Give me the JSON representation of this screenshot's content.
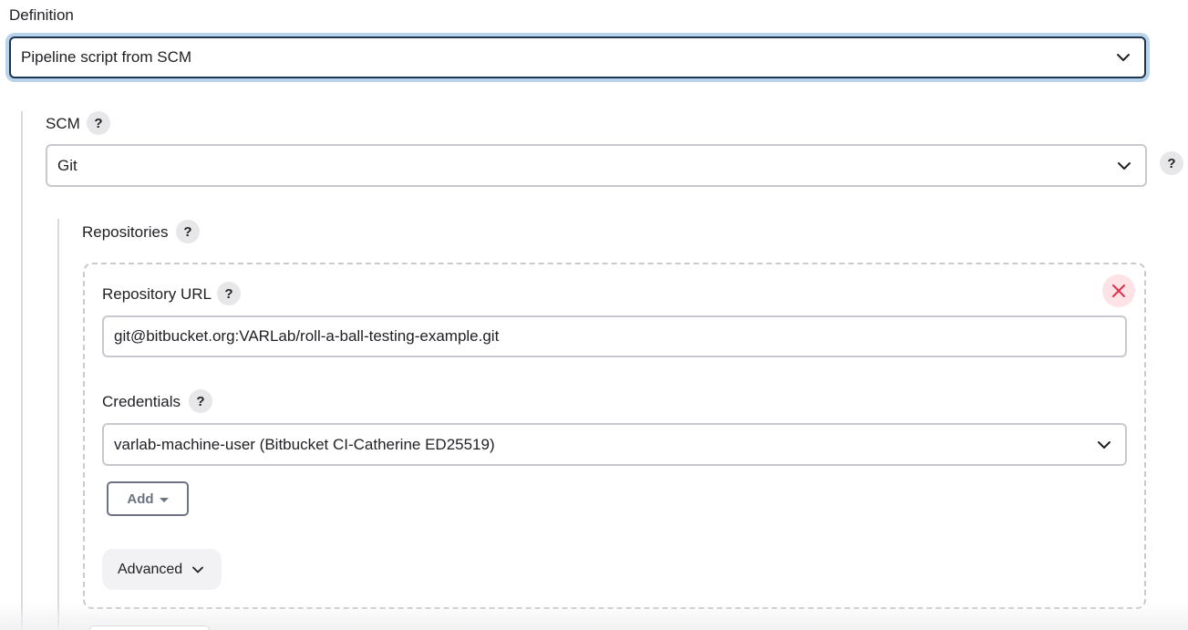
{
  "definition": {
    "label": "Definition",
    "selected": "Pipeline script from SCM"
  },
  "scm": {
    "label": "SCM",
    "help": "?",
    "selected": "Git",
    "side_help": "?"
  },
  "repositories": {
    "label": "Repositories",
    "help": "?",
    "repository_url": {
      "label": "Repository URL",
      "help": "?",
      "value": "git@bitbucket.org:VARLab/roll-a-ball-testing-example.git"
    },
    "credentials": {
      "label": "Credentials",
      "help": "?",
      "selected": "varlab-machine-user (Bitbucket CI-Catherine ED25519)"
    },
    "add_label": "Add",
    "advanced_label": "Advanced"
  },
  "colors": {
    "focus_border": "#1d3550",
    "focus_ring": "#b9d3ea",
    "delete": "#e0314b",
    "delete_bg": "#fde3e6"
  },
  "icons": {
    "dropdown": "chevron-down-icon",
    "delete": "close-icon",
    "add_caret": "caret-down-icon",
    "advanced": "chevron-down-icon"
  }
}
